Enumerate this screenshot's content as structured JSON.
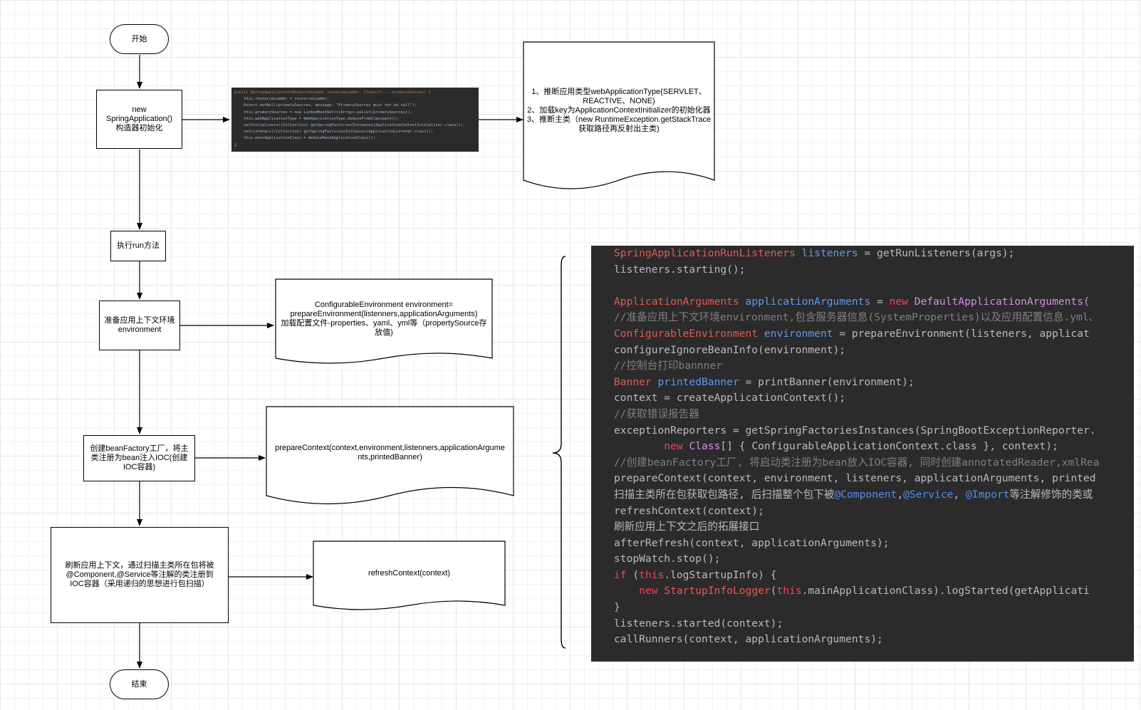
{
  "nodes": {
    "start": "开始",
    "init": "new\nSpringApplication()\n构造器初始化",
    "run": "执行run方法",
    "prepare_env": "准备应用上下文环境\nenvironment",
    "create_factory": "创建beanFactory工厂，将主类注册为bean注入IOC(创建IOC容器)",
    "refresh": "刷新应用上下文，通过扫描主类所在包将被@Component,@Service等注解的类注册到IOC容器（采用递归的思想进行包扫描）",
    "end": "结束"
  },
  "docs": {
    "init_desc": "1、推断应用类型webApplicationType(SERVLET、\nREACTIVE、NONE)\n2、加载key为ApplicationContextInitializer的初始化器\n3、推断主类（new RuntimeException.getStackTrace\n获取路径再反射出主类)",
    "env_desc": "ConfigurableEnvironment environment=\nprepareEnvironment(listenners,applicationArguments)\n加载配置文件-properties、yaml、yml等（propertySource存\n放值)",
    "context_desc": "prepareContext(context,environment,listenners,applicationArgume\nnts,printedBanner)",
    "refresh_desc": "refreshContext(context)"
  },
  "mini_code": [
    [
      {
        "t": "public SpringApplication(ResourceLoader resourceLoader, Class<?>... primarySources) {",
        "c": "kw"
      }
    ],
    [
      {
        "t": "    this.resourceLoader = resourceLoader;",
        "c": ""
      }
    ],
    [
      {
        "t": "    Assert.notNull(primarySources, message: \"PrimarySources must not be null\");",
        "c": ""
      }
    ],
    [
      {
        "t": "    this.primarySources = new LinkedHashSet<>(Arrays.asList(primarySources));",
        "c": ""
      }
    ],
    [
      {
        "t": "    this.webApplicationType = WebApplicationType.deduceFromClasspath();",
        "c": ""
      }
    ],
    [
      {
        "t": "    setInitializers((Collection) getSpringFactoriesInstances(ApplicationContextInitializer.class));",
        "c": ""
      }
    ],
    [
      {
        "t": "    setListeners((Collection) getSpringFactoriesInstances(ApplicationListener.class));",
        "c": ""
      }
    ],
    [
      {
        "t": "    this.mainApplicationClass = deduceMainApplicationClass();",
        "c": ""
      }
    ],
    [
      {
        "t": "}",
        "c": ""
      }
    ]
  ],
  "code_lines": [
    [
      {
        "t": "SpringApplicationRunListeners",
        "c": "type"
      },
      {
        "t": " ",
        "c": ""
      },
      {
        "t": "listeners",
        "c": "var"
      },
      {
        "t": " = getRunListeners(args);",
        "c": ""
      }
    ],
    [
      {
        "t": "listeners.starting();",
        "c": ""
      }
    ],
    [],
    [
      {
        "t": "ApplicationArguments",
        "c": "type"
      },
      {
        "t": " ",
        "c": ""
      },
      {
        "t": "applicationArguments",
        "c": "var"
      },
      {
        "t": " = ",
        "c": ""
      },
      {
        "t": "new",
        "c": "kw"
      },
      {
        "t": " ",
        "c": ""
      },
      {
        "t": "DefaultApplicationArguments(",
        "c": "cls"
      }
    ],
    [
      {
        "t": "//准备应用上下文环境environment,包含服务器信息(SystemProperties)以及应用配置信息.yml、",
        "c": "cmt"
      }
    ],
    [
      {
        "t": "ConfigurableEnvironment",
        "c": "type"
      },
      {
        "t": " ",
        "c": ""
      },
      {
        "t": "environment",
        "c": "var"
      },
      {
        "t": " = prepareEnvironment(listeners, applicat",
        "c": ""
      }
    ],
    [
      {
        "t": "configureIgnoreBeanInfo(environment);",
        "c": ""
      }
    ],
    [
      {
        "t": "//控制台打印bannner",
        "c": "cmt"
      }
    ],
    [
      {
        "t": "Banner",
        "c": "type"
      },
      {
        "t": " ",
        "c": ""
      },
      {
        "t": "printedBanner",
        "c": "var"
      },
      {
        "t": " = printBanner(environment);",
        "c": ""
      }
    ],
    [
      {
        "t": "context = createApplicationContext();",
        "c": ""
      }
    ],
    [
      {
        "t": "//获取错误报告器",
        "c": "cmt"
      }
    ],
    [
      {
        "t": "exceptionReporters = getSpringFactoriesInstances(SpringBootExceptionReporter.",
        "c": ""
      }
    ],
    [
      {
        "t": "        ",
        "c": ""
      },
      {
        "t": "new",
        "c": "kw"
      },
      {
        "t": " ",
        "c": ""
      },
      {
        "t": "Class",
        "c": "cls"
      },
      {
        "t": "[] { ConfigurableApplicationContext.class }, context);",
        "c": ""
      }
    ],
    [
      {
        "t": "//创建beanFactory工厂, 将启动类注册为bean放入IOC容器, 同时创建annotatedReader,xmlRea",
        "c": "cmt"
      }
    ],
    [
      {
        "t": "prepareContext(context, environment, listeners, applicationArguments, printed",
        "c": ""
      }
    ],
    [
      {
        "t": "扫描主类所在包获取包路径, 后扫描整个包下被",
        "c": ""
      },
      {
        "t": "@Component",
        "c": "ann"
      },
      {
        "t": ",",
        "c": ""
      },
      {
        "t": "@Service",
        "c": "ann"
      },
      {
        "t": ", ",
        "c": ""
      },
      {
        "t": "@Import",
        "c": "ann"
      },
      {
        "t": "等注解修饰的类或",
        "c": ""
      }
    ],
    [
      {
        "t": "refreshContext(context);",
        "c": ""
      }
    ],
    [
      {
        "t": "刷新应用上下文之后的拓展接口",
        "c": ""
      }
    ],
    [
      {
        "t": "afterRefresh(context, applicationArguments);",
        "c": ""
      }
    ],
    [
      {
        "t": "stopWatch.stop();",
        "c": ""
      }
    ],
    [
      {
        "t": "if",
        "c": "kw"
      },
      {
        "t": " (",
        "c": ""
      },
      {
        "t": "this",
        "c": "this"
      },
      {
        "t": ".logStartupInfo) {",
        "c": ""
      }
    ],
    [
      {
        "t": "    ",
        "c": ""
      },
      {
        "t": "new",
        "c": "kw"
      },
      {
        "t": " ",
        "c": ""
      },
      {
        "t": "StartupInfoLogger",
        "c": "type"
      },
      {
        "t": "(",
        "c": ""
      },
      {
        "t": "this",
        "c": "this"
      },
      {
        "t": ".mainApplicationClass).logStarted(getApplicati",
        "c": ""
      }
    ],
    [
      {
        "t": "}",
        "c": ""
      }
    ],
    [
      {
        "t": "listeners.started(context);",
        "c": ""
      }
    ],
    [
      {
        "t": "callRunners(context, applicationArguments);",
        "c": ""
      }
    ]
  ]
}
